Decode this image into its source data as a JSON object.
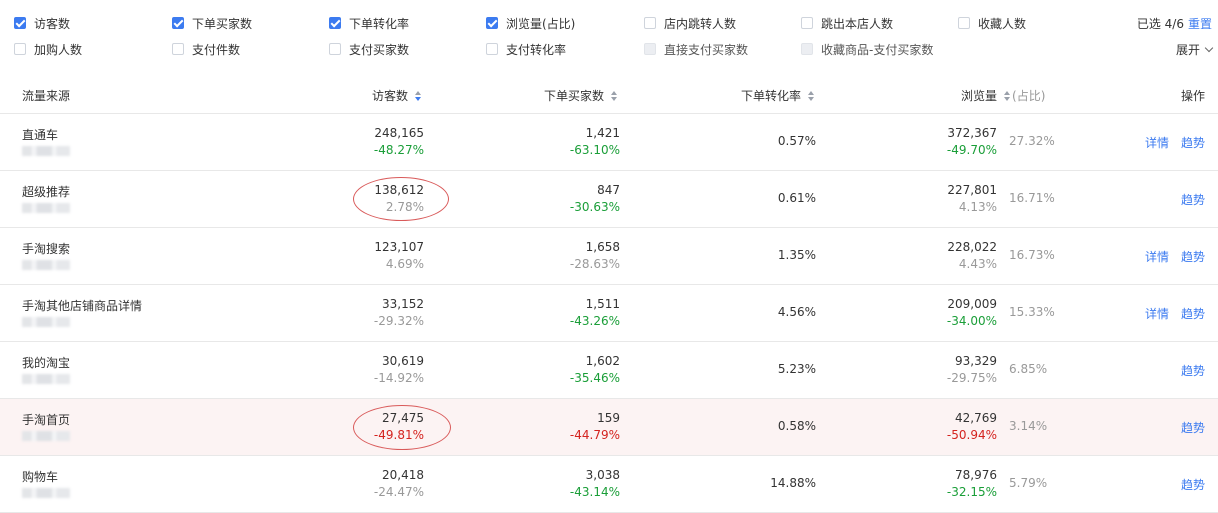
{
  "filters": {
    "options": [
      {
        "label": "访客数",
        "state": "checked"
      },
      {
        "label": "下单买家数",
        "state": "checked"
      },
      {
        "label": "下单转化率",
        "state": "checked"
      },
      {
        "label": "浏览量(占比)",
        "state": "checked"
      },
      {
        "label": "店内跳转人数",
        "state": "unchecked"
      },
      {
        "label": "跳出本店人数",
        "state": "unchecked"
      },
      {
        "label": "收藏人数",
        "state": "unchecked"
      },
      {
        "label": "加购人数",
        "state": "unchecked"
      },
      {
        "label": "支付件数",
        "state": "unchecked"
      },
      {
        "label": "支付买家数",
        "state": "unchecked"
      },
      {
        "label": "支付转化率",
        "state": "unchecked"
      },
      {
        "label": "直接支付买家数",
        "state": "disabled"
      },
      {
        "label": "收藏商品-支付买家数",
        "state": "disabled"
      }
    ],
    "selected_info": "已选 4/6",
    "reset_label": "重置",
    "expand_label": "展开"
  },
  "table": {
    "headers": {
      "source": "流量来源",
      "visitors": "访客数",
      "buyers": "下单买家数",
      "conversion": "下单转化率",
      "pageviews": "浏览量",
      "share": "(占比)",
      "actions": "操作"
    },
    "sorted_column": "visitors",
    "rows": [
      {
        "source": "直通车",
        "visitors": "248,165",
        "visitors_change": "-48.27%",
        "visitors_trend": "down",
        "buyers": "1,421",
        "buyers_change": "-63.10%",
        "buyers_trend": "down",
        "conversion": "0.57%",
        "pageviews": "372,367",
        "pageviews_change": "-49.70%",
        "pageviews_trend": "down",
        "share": "27.32%",
        "detail": "详情",
        "trend": "趋势",
        "highlight": false
      },
      {
        "source": "超级推荐",
        "visitors": "138,612",
        "visitors_change": "2.78%",
        "visitors_trend": "up",
        "buyers": "847",
        "buyers_change": "-30.63%",
        "buyers_trend": "down",
        "conversion": "0.61%",
        "pageviews": "227,801",
        "pageviews_change": "4.13%",
        "pageviews_trend": "up",
        "share": "16.71%",
        "detail": "",
        "trend": "趋势",
        "highlight": false
      },
      {
        "source": "手淘搜索",
        "visitors": "123,107",
        "visitors_change": "4.69%",
        "visitors_trend": "up",
        "buyers": "1,658",
        "buyers_change": "-28.63%",
        "buyers_trend": "down_muted",
        "conversion": "1.35%",
        "pageviews": "228,022",
        "pageviews_change": "4.43%",
        "pageviews_trend": "up",
        "share": "16.73%",
        "detail": "详情",
        "trend": "趋势",
        "highlight": false
      },
      {
        "source": "手淘其他店铺商品详情",
        "visitors": "33,152",
        "visitors_change": "-29.32%",
        "visitors_trend": "down_muted",
        "buyers": "1,511",
        "buyers_change": "-43.26%",
        "buyers_trend": "down",
        "conversion": "4.56%",
        "pageviews": "209,009",
        "pageviews_change": "-34.00%",
        "pageviews_trend": "down",
        "share": "15.33%",
        "detail": "详情",
        "trend": "趋势",
        "highlight": false
      },
      {
        "source": "我的淘宝",
        "visitors": "30,619",
        "visitors_change": "-14.92%",
        "visitors_trend": "down_muted",
        "buyers": "1,602",
        "buyers_change": "-35.46%",
        "buyers_trend": "down",
        "conversion": "5.23%",
        "pageviews": "93,329",
        "pageviews_change": "-29.75%",
        "pageviews_trend": "down_muted",
        "share": "6.85%",
        "detail": "",
        "trend": "趋势",
        "highlight": false
      },
      {
        "source": "手淘首页",
        "visitors": "27,475",
        "visitors_change": "-49.81%",
        "visitors_trend": "red",
        "buyers": "159",
        "buyers_change": "-44.79%",
        "buyers_trend": "red",
        "conversion": "0.58%",
        "pageviews": "42,769",
        "pageviews_change": "-50.94%",
        "pageviews_trend": "red",
        "share": "3.14%",
        "detail": "",
        "trend": "趋势",
        "highlight": true
      },
      {
        "source": "购物车",
        "visitors": "20,418",
        "visitors_change": "-24.47%",
        "visitors_trend": "down_muted",
        "buyers": "3,038",
        "buyers_change": "-43.14%",
        "buyers_trend": "down",
        "conversion": "14.88%",
        "pageviews": "78,976",
        "pageviews_change": "-32.15%",
        "pageviews_trend": "down",
        "share": "5.79%",
        "detail": "",
        "trend": "趋势",
        "highlight": false
      }
    ]
  },
  "colors": {
    "accent": "#3c7bf0",
    "decrease": "#1a9e38",
    "alert": "#d4231f",
    "annotation_circle": "#d95a5a",
    "highlight_row": "#fcf3f3"
  }
}
